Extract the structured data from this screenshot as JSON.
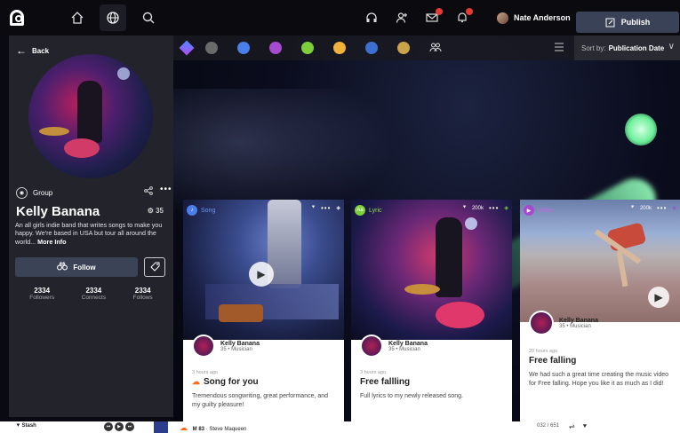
{
  "nav": {
    "icons": [
      "home-icon",
      "globe-icon",
      "search-icon"
    ]
  },
  "user": {
    "name": "Nate Anderson"
  },
  "publish_label": "Publish",
  "filters": {
    "dot_colors": [
      "#6a6a6a",
      "#4a7ee8",
      "#a64bd0",
      "#7ccf3a",
      "#f0b23a",
      "#3d6fd0",
      "#c9a24a"
    ]
  },
  "sort": {
    "prefix": "Sort by:",
    "value": "Publication Date"
  },
  "profile": {
    "back_label": "Back",
    "type": "Group",
    "name": "Kelly Banana",
    "score": "35",
    "bio": "An all girls indie band that writes songs to make you happy. We're based in USA but tour all around the world...",
    "more_info": "More Info",
    "follow_label": "Follow",
    "stats": [
      {
        "num": "2334",
        "label": "Followers"
      },
      {
        "num": "2334",
        "label": "Connects"
      },
      {
        "num": "2334",
        "label": "Follows"
      }
    ]
  },
  "cards": [
    {
      "type": "Song",
      "type_color": "#4a7ee8",
      "count": "",
      "author": "Kelly Banana",
      "role": "35 • Musician",
      "time": "3 hours ago",
      "title": "Song for you",
      "desc": "Tremendous songwriting, great performance, and my guilty pleasure!"
    },
    {
      "type": "Lyric",
      "type_color": "#7ccf3a",
      "count": "200k",
      "author": "Kelly Banana",
      "role": "35 • Musician",
      "time": "3 hours ago",
      "title": "Free fallling",
      "desc": "Full lyrics to my newly released song."
    },
    {
      "type": "Video",
      "type_color": "#a64bd0",
      "count": "200k",
      "author": "Kelly Banana",
      "role": "35 • Musician",
      "time": "20 hours ago",
      "title": "Free falling",
      "desc": "We had such a great time creating the music video for Free falling. Hope you like it as much as I did!"
    }
  ],
  "player": {
    "stash_label": "Stash",
    "track_title": "M 83",
    "track_artist": "Steve Maqueen",
    "time": "032 / 651"
  }
}
